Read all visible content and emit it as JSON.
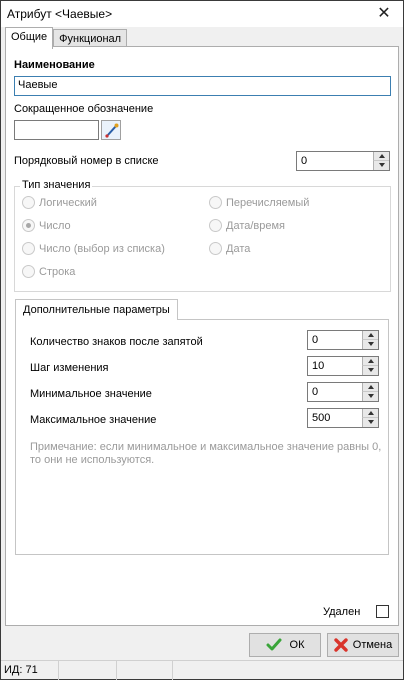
{
  "window": {
    "title": "Атрибут <Чаевые>",
    "close_icon": "close-icon"
  },
  "tabs": [
    {
      "label": "Общие",
      "active": true
    },
    {
      "label": "Функционал",
      "active": false
    }
  ],
  "general": {
    "name_label": "Наименование",
    "name_value": "Чаевые",
    "short_label": "Сокращенное обозначение",
    "short_value": "",
    "order_label": "Порядковый номер в списке",
    "order_value": "0"
  },
  "value_type": {
    "legend": "Тип значения",
    "options": [
      {
        "label": "Логический",
        "checked": false
      },
      {
        "label": "Число",
        "checked": true
      },
      {
        "label": "Число (выбор из списка)",
        "checked": false
      },
      {
        "label": "Строка",
        "checked": false
      },
      {
        "label": "Перечисляемый",
        "checked": false
      },
      {
        "label": "Дата/время",
        "checked": false
      },
      {
        "label": "Дата",
        "checked": false
      }
    ]
  },
  "extra": {
    "tab_label": "Дополнительные параметры",
    "fields": [
      {
        "label": "Количество знаков после запятой",
        "value": "0"
      },
      {
        "label": "Шаг изменения",
        "value": "10"
      },
      {
        "label": "Минимальное значение",
        "value": "0"
      },
      {
        "label": "Максимальное значение",
        "value": "500"
      }
    ],
    "note_line1": "Примечание: если минимальное и максимальное значение равны 0,",
    "note_line2": "то они не используются."
  },
  "deleted": {
    "label": "Удален",
    "checked": false
  },
  "buttons": {
    "ok": "ОК",
    "cancel": "Отмена"
  },
  "colors": {
    "ok_icon": "#3aa53a",
    "cancel_icon": "#d9342b",
    "focus_border": "#3c7fb1"
  },
  "statusbar": {
    "id_text": "ИД: 71"
  }
}
